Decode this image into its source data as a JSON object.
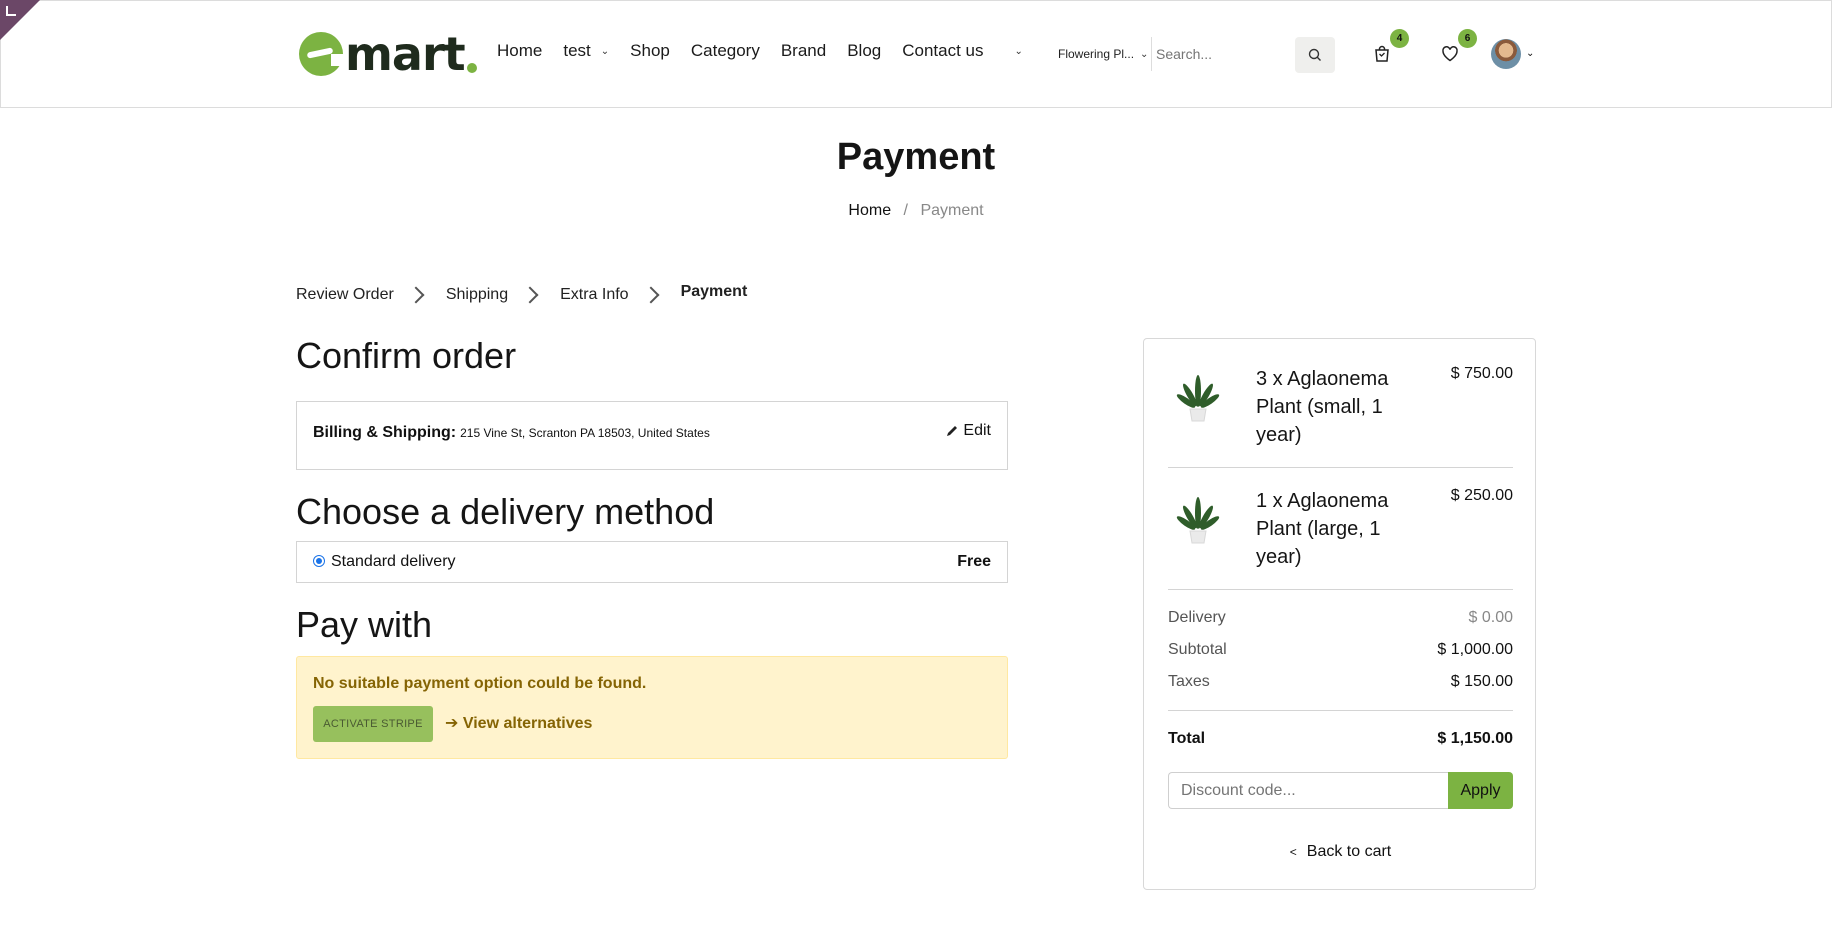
{
  "header": {
    "logo_text": "mart",
    "nav": [
      {
        "label": "Home"
      },
      {
        "label": "test"
      },
      {
        "label": "Shop"
      },
      {
        "label": "Category"
      },
      {
        "label": "Brand"
      },
      {
        "label": "Blog"
      },
      {
        "label": "Contact us"
      }
    ],
    "category_selected": "Flowering Pl...",
    "search_placeholder": "Search...",
    "cart_count": "4",
    "wishlist_count": "6",
    "accent": "#7cb342"
  },
  "page": {
    "title": "Payment",
    "breadcrumb": {
      "home": "Home",
      "separator": "/",
      "current": "Payment"
    }
  },
  "steps": [
    "Review Order",
    "Shipping",
    "Extra Info",
    "Payment"
  ],
  "confirm": {
    "heading": "Confirm order",
    "billing_label": "Billing & Shipping:",
    "billing_address": "215 Vine St, Scranton PA 18503, United States",
    "edit_label": "Edit"
  },
  "delivery": {
    "heading": "Choose a delivery method",
    "method": "Standard delivery",
    "price": "Free"
  },
  "payment": {
    "heading": "Pay with",
    "alert": "No suitable payment option could be found.",
    "stripe_button": "ACTIVATE STRIPE",
    "alternatives_link": "➔ View alternatives"
  },
  "summary": {
    "items": [
      {
        "name": "3 x Aglaonema Plant (small, 1 year)",
        "price": "$ 750.00"
      },
      {
        "name": "1 x Aglaonema Plant (large, 1 year)",
        "price": "$ 250.00"
      }
    ],
    "delivery_label": "Delivery",
    "delivery_value": "$ 0.00",
    "subtotal_label": "Subtotal",
    "subtotal_value": "$ 1,000.00",
    "taxes_label": "Taxes",
    "taxes_value": "$ 150.00",
    "total_label": "Total",
    "total_value": "$ 1,150.00",
    "discount_placeholder": "Discount code...",
    "apply_label": "Apply",
    "back_label": "Back to cart"
  }
}
